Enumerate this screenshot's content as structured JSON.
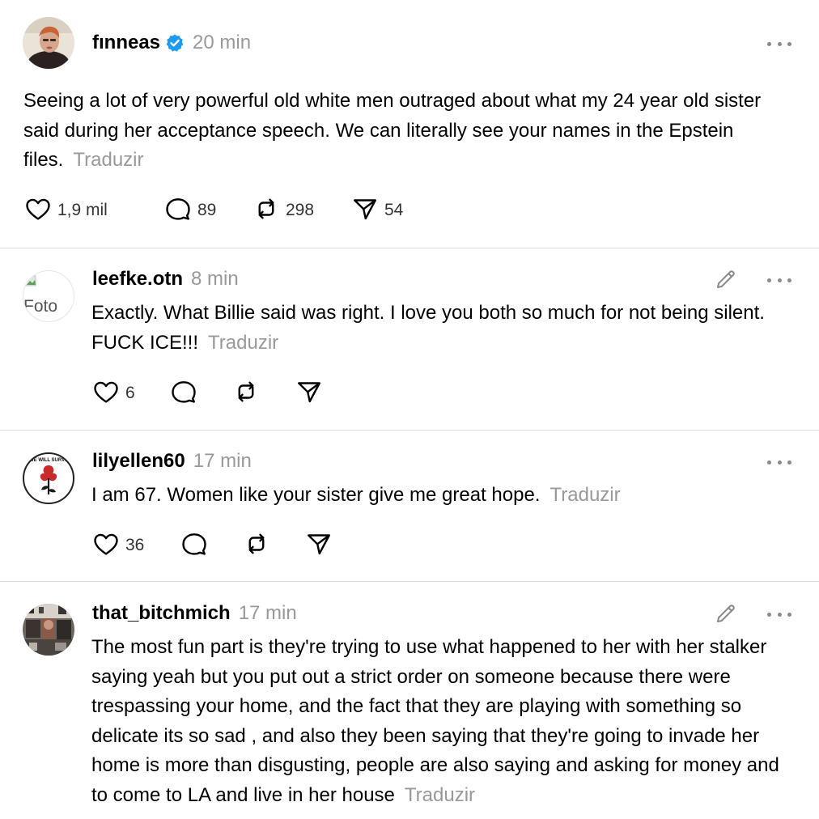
{
  "main_post": {
    "username": "fınneas",
    "time": "20 min",
    "text": "Seeing a lot of very powerful old white men outraged about what my 24 year old sister said during her acceptance speech. We can literally see your names in the Epstein files.",
    "translate_label": "Traduzir",
    "likes": "1,9 mil",
    "replies": "89",
    "reposts": "298",
    "shares": "54"
  },
  "replies": [
    {
      "username": "leefke.otn",
      "time": "8 min",
      "avatar_alt": "Foto",
      "text": "Exactly. What Billie said was right. I love you both so much for not being silent. FUCK ICE!!!",
      "translate_label": "Traduzir",
      "likes": "6"
    },
    {
      "username": "lilyellen60",
      "time": "17 min",
      "avatar_text": "WE WILL SURVIVE",
      "text": "I am 67. Women like your sister give me great hope.",
      "translate_label": "Traduzir",
      "likes": "36"
    },
    {
      "username": "that_bitchmich",
      "time": "17 min",
      "text": "The most fun part is they're trying to use what happened to her with her stalker saying yeah but you put out a strict order on someone because there were trespassing your home, and the fact that they are playing with something so delicate its so sad , and also they been saying that they're going to invade her home is more than disgusting, people are also saying and asking for money and to come to LA and live in her house",
      "translate_label": "Traduzir"
    }
  ],
  "icons": {
    "like": "heart-icon",
    "reply": "comment-icon",
    "repost": "repost-icon",
    "share": "send-icon",
    "verified": "verified-badge-icon",
    "more": "more-options-icon",
    "edit": "pencil-icon"
  },
  "colors": {
    "verified_badge": "#1D9BF0",
    "muted_text": "#999999",
    "divider": "#DCDCDC",
    "icon_stroke": "#000000"
  }
}
